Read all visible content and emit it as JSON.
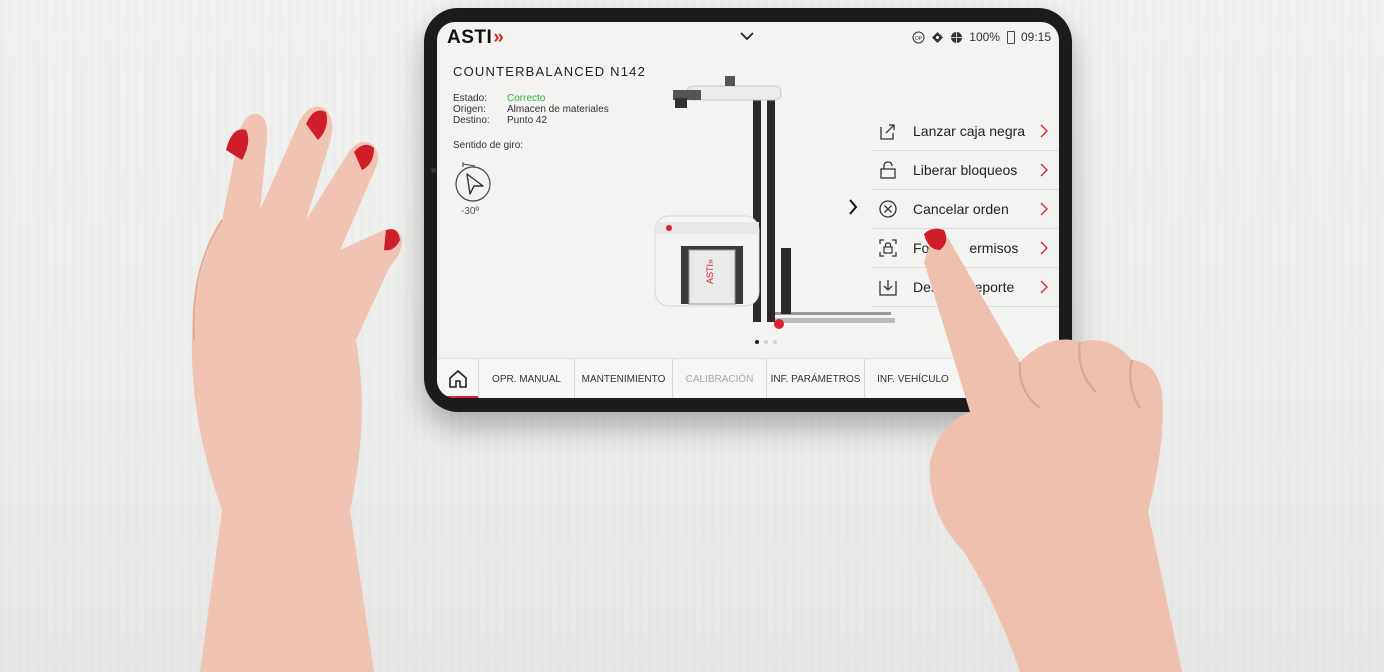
{
  "app": {
    "logo_text": "ASTI",
    "brand_color": "#d7262f"
  },
  "statusbar": {
    "icons": [
      "op-icon",
      "gps-icon",
      "globe-icon",
      "battery-icon"
    ],
    "battery": "100%",
    "time": "09:15"
  },
  "vehicle": {
    "title": "COUNTERBALANCED N142",
    "fields": [
      {
        "label": "Estado:",
        "value": "Correcto"
      },
      {
        "label": "Origen:",
        "value": "Almacen de materiales"
      },
      {
        "label": "Destino:",
        "value": "Punto 42"
      }
    ],
    "status_color": "#2fb32f",
    "rotation_label": "Sentido de giro:",
    "rotation_value": "-30º"
  },
  "carousel": {
    "pages": 3,
    "active": 1
  },
  "menu": {
    "items": [
      {
        "label": "Lanzar caja negra",
        "icon": "export-icon"
      },
      {
        "label": "Liberar bloqueos",
        "icon": "unlock-icon"
      },
      {
        "label": "Cancelar orden",
        "icon": "cancel-icon"
      },
      {
        "label": "Fo",
        "label_tail": "ermisos",
        "icon": "lock-frame-icon"
      },
      {
        "label": "Des",
        "label_tail": "reporte",
        "icon": "download-icon"
      }
    ]
  },
  "nav": {
    "home_icon": "home-icon",
    "tabs": [
      {
        "label": "OPR. MANUAL",
        "enabled": true
      },
      {
        "label": "MANTENIMIENTO",
        "enabled": true
      },
      {
        "label": "CALIBRACIÓN",
        "enabled": false
      },
      {
        "label": "INF. PARÁMETROS",
        "enabled": true
      },
      {
        "label": "INF. VEHÍCULO",
        "enabled": true
      }
    ]
  }
}
